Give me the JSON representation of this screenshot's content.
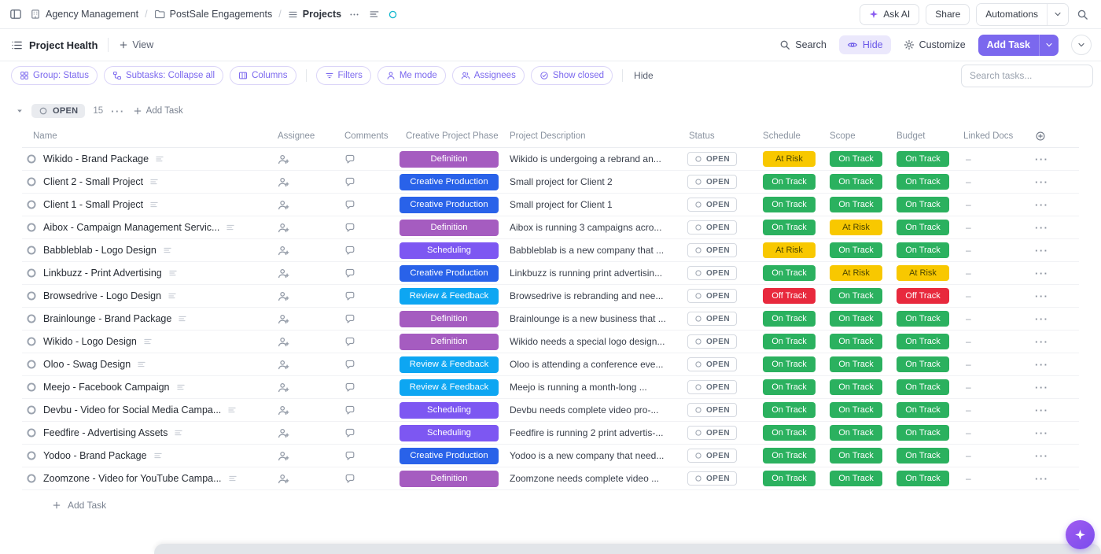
{
  "topbar": {
    "breadcrumb": {
      "workspace": "Agency Management",
      "folder": "PostSale Engagements",
      "list": "Projects"
    },
    "ask_ai_label": "Ask AI",
    "share_label": "Share",
    "automations_label": "Automations"
  },
  "viewbar": {
    "view_label": "Project Health",
    "add_view_label": "View",
    "search_label": "Search",
    "hide_label": "Hide",
    "customize_label": "Customize",
    "add_task_label": "Add Task"
  },
  "toolbar": {
    "group_label": "Group: Status",
    "subtasks_label": "Subtasks: Collapse all",
    "columns_label": "Columns",
    "filters_label": "Filters",
    "me_mode_label": "Me mode",
    "assignees_label": "Assignees",
    "show_closed_label": "Show closed",
    "hide_label": "Hide",
    "search_placeholder": "Search tasks..."
  },
  "group_header": {
    "status": "OPEN",
    "count": "15",
    "add_task_label": "Add Task"
  },
  "table": {
    "columns": [
      "Name",
      "Assignee",
      "Comments",
      "Creative Project Phase",
      "Project Description",
      "Status",
      "Schedule",
      "Scope",
      "Budget",
      "Linked Docs"
    ],
    "rows": [
      {
        "name": "Wikido - Brand Package",
        "phase": "Definition",
        "description": "Wikido is undergoing a rebrand an...",
        "status": "OPEN",
        "schedule": "At Risk",
        "scope": "On Track",
        "budget": "On Track",
        "linked_docs": "–"
      },
      {
        "name": "Client 2 - Small Project",
        "phase": "Creative Production",
        "description": "Small project for Client 2",
        "status": "OPEN",
        "schedule": "On Track",
        "scope": "On Track",
        "budget": "On Track",
        "linked_docs": "–"
      },
      {
        "name": "Client 1 - Small Project",
        "phase": "Creative Production",
        "description": "Small project for Client 1",
        "status": "OPEN",
        "schedule": "On Track",
        "scope": "On Track",
        "budget": "On Track",
        "linked_docs": "–"
      },
      {
        "name": "Aibox - Campaign Management Servic...",
        "phase": "Definition",
        "description": "Aibox is running 3 campaigns acro...",
        "status": "OPEN",
        "schedule": "On Track",
        "scope": "At Risk",
        "budget": "On Track",
        "linked_docs": "–"
      },
      {
        "name": "Babbleblab - Logo Design",
        "phase": "Scheduling",
        "description": "Babbleblab is a new company that ...",
        "status": "OPEN",
        "schedule": "At Risk",
        "scope": "On Track",
        "budget": "On Track",
        "linked_docs": "–"
      },
      {
        "name": "Linkbuzz - Print Advertising",
        "phase": "Creative Production",
        "description": "Linkbuzz is running print advertisin...",
        "status": "OPEN",
        "schedule": "On Track",
        "scope": "At Risk",
        "budget": "At Risk",
        "linked_docs": "–"
      },
      {
        "name": "Browsedrive - Logo Design",
        "phase": "Review & Feedback",
        "description": "Browsedrive is rebranding and nee...",
        "status": "OPEN",
        "schedule": "Off Track",
        "scope": "On Track",
        "budget": "Off Track",
        "linked_docs": "–"
      },
      {
        "name": "Brainlounge - Brand Package",
        "phase": "Definition",
        "description": "Brainlounge is a new business that ...",
        "status": "OPEN",
        "schedule": "On Track",
        "scope": "On Track",
        "budget": "On Track",
        "linked_docs": "–"
      },
      {
        "name": "Wikido - Logo Design",
        "phase": "Definition",
        "description": "Wikido needs a special logo design...",
        "status": "OPEN",
        "schedule": "On Track",
        "scope": "On Track",
        "budget": "On Track",
        "linked_docs": "–"
      },
      {
        "name": "Oloo - Swag Design",
        "phase": "Review & Feedback",
        "description": "Oloo is attending a conference eve...",
        "status": "OPEN",
        "schedule": "On Track",
        "scope": "On Track",
        "budget": "On Track",
        "linked_docs": "–"
      },
      {
        "name": "Meejo - Facebook Campaign",
        "phase": "Review & Feedback",
        "description": "Meejo is running a month-long ...",
        "status": "OPEN",
        "schedule": "On Track",
        "scope": "On Track",
        "budget": "On Track",
        "linked_docs": "–"
      },
      {
        "name": "Devbu - Video for Social Media Campa...",
        "phase": "Scheduling",
        "description": "Devbu needs complete video pro-...",
        "status": "OPEN",
        "schedule": "On Track",
        "scope": "On Track",
        "budget": "On Track",
        "linked_docs": "–"
      },
      {
        "name": "Feedfire - Advertising Assets",
        "phase": "Scheduling",
        "description": "Feedfire is running 2 print advertis-...",
        "status": "OPEN",
        "schedule": "On Track",
        "scope": "On Track",
        "budget": "On Track",
        "linked_docs": "–"
      },
      {
        "name": "Yodoo - Brand Package",
        "phase": "Creative Production",
        "description": "Yodoo is a new company that need...",
        "status": "OPEN",
        "schedule": "On Track",
        "scope": "On Track",
        "budget": "On Track",
        "linked_docs": "–"
      },
      {
        "name": "Zoomzone - Video for YouTube Campa...",
        "phase": "Definition",
        "description": "Zoomzone needs complete video ...",
        "status": "OPEN",
        "schedule": "On Track",
        "scope": "On Track",
        "budget": "On Track",
        "linked_docs": "–"
      }
    ]
  },
  "footer": {
    "add_task_label": "Add Task"
  },
  "colors": {
    "accent": "#7b68ee",
    "phase": {
      "Definition": "#a55cc0",
      "Creative Production": "#2962e9",
      "Scheduling": "#7d57f2",
      "Review & Feedback": "#0da6f2"
    },
    "health": {
      "On Track": "#2bb15f",
      "At Risk": "#f8c800",
      "Off Track": "#e8293d"
    },
    "health_text": {
      "On Track": "#ffffff",
      "At Risk": "#4d4600",
      "Off Track": "#ffffff"
    }
  }
}
